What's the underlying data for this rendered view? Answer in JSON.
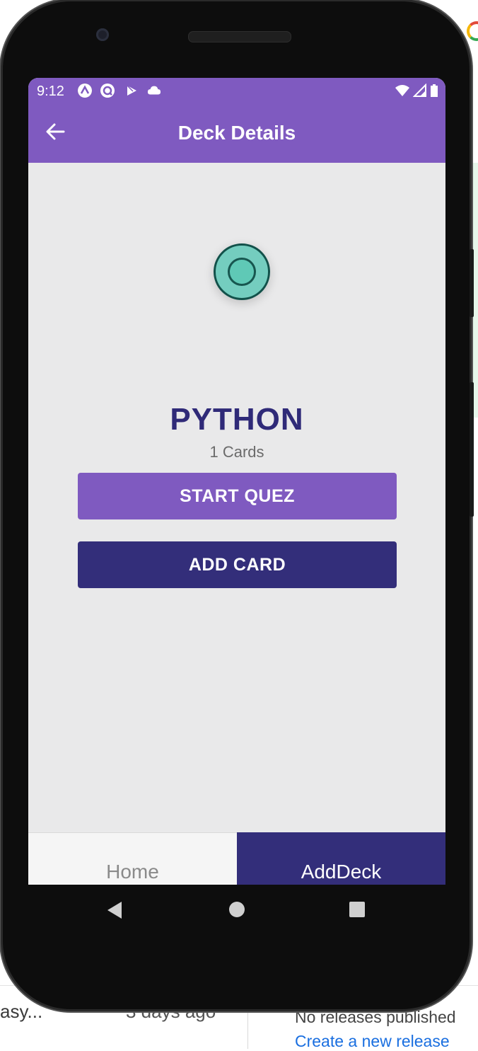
{
  "background_page": {
    "left_text": "asy...",
    "middle_text": "3 days ago",
    "right_text": "No releases published",
    "link_text": "Create a new release"
  },
  "status_bar": {
    "time": "9:12",
    "icons": [
      "expo-icon",
      "at-icon",
      "play-store-icon",
      "cloud-icon"
    ],
    "right_icons": [
      "wifi-icon",
      "signal-icon",
      "battery-icon"
    ]
  },
  "app_bar": {
    "title": "Deck Details",
    "back_icon": "arrow-back-icon"
  },
  "deck": {
    "title": "PYTHON",
    "count": "1 Cards"
  },
  "actions": {
    "start_label": "START QUEZ",
    "add_label": "ADD CARD"
  },
  "tabs": [
    {
      "label": "Home",
      "active": false
    },
    {
      "label": "AddDeck",
      "active": true
    }
  ],
  "nav_bar": {
    "icons": [
      "back-triangle-icon",
      "home-circle-icon",
      "recents-square-icon"
    ]
  },
  "colors": {
    "primary": "#7f5ac0",
    "dark": "#332e7a",
    "title": "#2f2a78",
    "screen_bg": "#e9e9ea",
    "loader": "#5fc9b6"
  }
}
